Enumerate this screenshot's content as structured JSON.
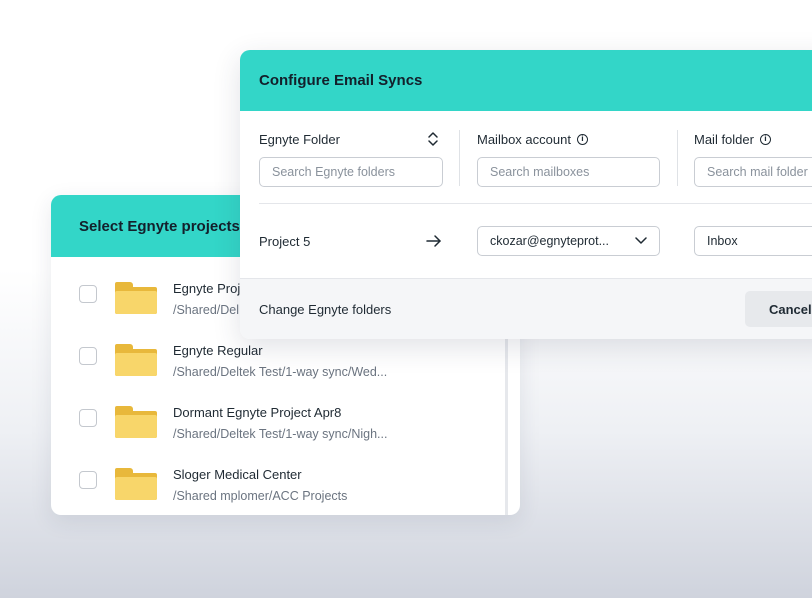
{
  "projects_panel": {
    "title": "Select Egnyte projects",
    "items": [
      {
        "name": "Egnyte Proj",
        "path": "/Shared/Del"
      },
      {
        "name": "Egnyte Regular",
        "path": "/Shared/Deltek Test/1-way sync/Wed..."
      },
      {
        "name": "Dormant Egnyte Project Apr8",
        "path": "/Shared/Deltek Test/1-way sync/Nigh..."
      },
      {
        "name": "Sloger Medical Center",
        "path": "/Shared mplomer/ACC Projects"
      }
    ]
  },
  "config_panel": {
    "title": "Configure Email Syncs",
    "columns": {
      "folder": {
        "label": "Egnyte Folder",
        "placeholder": "Search Egnyte folders"
      },
      "mailbox": {
        "label": "Mailbox account",
        "placeholder": "Search mailboxes"
      },
      "mail_folder": {
        "label": "Mail folder",
        "placeholder": "Search mail folder"
      }
    },
    "row": {
      "project": "Project 5",
      "mailbox_value": "ckozar@egnyteprot...",
      "mail_folder_value": "Inbox"
    },
    "footer": {
      "change_link": "Change Egnyte folders",
      "cancel": "Cancel"
    }
  },
  "colors": {
    "accent": "#33d6c8",
    "folder": "#f8d66a"
  }
}
